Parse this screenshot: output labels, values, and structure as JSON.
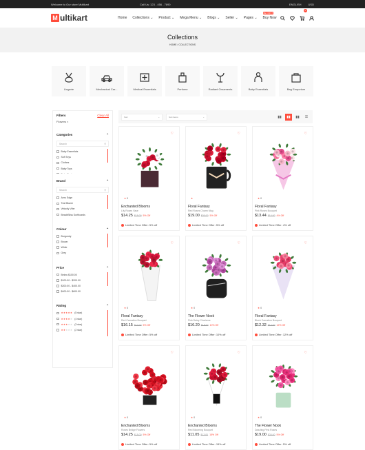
{
  "topbar": {
    "welcome": "Welcome to Our store Multikart",
    "phone": "Call Us: 123 - 456 - 7890",
    "language": "ENGLISH",
    "currency": "USD"
  },
  "header": {
    "logo_mark": "M",
    "logo_text": "ultikart",
    "nav": [
      {
        "label": "Home"
      },
      {
        "label": "Collections"
      },
      {
        "label": "Product"
      },
      {
        "label": "Mega Menu"
      },
      {
        "label": "Blogs"
      },
      {
        "label": "Seller"
      },
      {
        "label": "Pages"
      },
      {
        "label": "Buy Now",
        "badge": "BE FIRST"
      }
    ],
    "cart_count": "0"
  },
  "banner": {
    "title": "Collections",
    "breadcrumb": "HOME / COLLECTIONS"
  },
  "categories": [
    {
      "label": "Lingerie",
      "icon": "lingerie-icon"
    },
    {
      "label": "Mechanical Car...",
      "icon": "car-icon"
    },
    {
      "label": "Medical Essentials",
      "icon": "medical-icon"
    },
    {
      "label": "Perfume",
      "icon": "perfume-icon"
    },
    {
      "label": "Radiant Ornaments",
      "icon": "ornament-icon"
    },
    {
      "label": "Baby Essentials",
      "icon": "baby-icon"
    },
    {
      "label": "Bag Emporium",
      "icon": "bag-icon"
    }
  ],
  "filters": {
    "title": "Filters",
    "clear": "Clear All",
    "selected": "Flowers",
    "categories": {
      "title": "Categories",
      "placeholder": "Search",
      "items": [
        "Baby Essentials",
        "Soft Toys",
        "Clothes",
        "Baby Toys",
        "Baby Footware"
      ]
    },
    "brand": {
      "title": "Brand",
      "placeholder": "Search",
      "items": [
        "Aero Edge",
        "Trail Blazer",
        "Velocity Vibe",
        "BeachBliss Surfboards"
      ]
    },
    "colour": {
      "title": "Colour",
      "items": [
        "Burgundy",
        "Brown",
        "White",
        "Grey"
      ]
    },
    "price": {
      "title": "Price",
      "items": [
        "Below $100.00",
        "$100.00 - $200.00",
        "$200.00 - $400.00",
        "$400.00 - $600.00"
      ]
    },
    "rating": {
      "title": "Rating",
      "items": [
        {
          "stars": 5,
          "label": "(5 star)"
        },
        {
          "stars": 4,
          "label": "(4 star)"
        },
        {
          "stars": 3,
          "label": "(3 star)"
        },
        {
          "stars": 2,
          "label": "(2 star)"
        }
      ]
    }
  },
  "toolbar": {
    "sort": "Sort",
    "sort_items": "Sort Items"
  },
  "products": [
    {
      "rating": "0",
      "name": "Enchanted Blooms",
      "desc": "Lily Roses Vase",
      "price": "$14.25",
      "old": "$15.00",
      "off": "5% Off",
      "offer": "Limited Time Offer: 5% off",
      "img": "mix"
    },
    {
      "rating": "",
      "name": "Floral Fantasy",
      "desc": "Red Roses Charm Mug",
      "price": "$19.00",
      "old": "$20.00",
      "off": "5% Off",
      "offer": "Limited Time Offer: 5% off",
      "img": "red-mug"
    },
    {
      "rating": "0",
      "name": "Floral Fantasy",
      "desc": "Pink Roses Bouquet",
      "price": "$13.44",
      "old": "$14.00",
      "off": "4% Off",
      "offer": "Limited Time Offer: 4% off",
      "img": "pink-bouquet"
    },
    {
      "rating": "0",
      "name": "Floral Fantasy",
      "desc": "Red Carnation Bouquet",
      "price": "$16.15",
      "old": "$17.00",
      "off": "5% Off",
      "offer": "Limited Time Offer: 5% off",
      "img": "red-cone"
    },
    {
      "rating": "0",
      "name": "The Flower Nook",
      "desc": "Pink Daisy Charisma",
      "price": "$16.20",
      "old": "$18.00",
      "off": "10% Off",
      "offer": "Limited Time Offer: 10% off",
      "img": "purple-box"
    },
    {
      "rating": "0",
      "name": "Floral Fantasy",
      "desc": "Blush Carnation Bouquet",
      "price": "$12.32",
      "old": "$14.00",
      "off": "12% Off",
      "offer": "Limited Time Offer: 12% off",
      "img": "pink-wrap"
    },
    {
      "rating": "0",
      "name": "Enchanted Blooms",
      "desc": "Roses Bridge Flowers",
      "price": "$14.25",
      "old": "$15.00",
      "off": "5% Off",
      "offer": "Limited Time Offer: 5% off",
      "img": "red-dome"
    },
    {
      "rating": "0",
      "name": "Enchanted Blooms",
      "desc": "Red Blooming Bouquet",
      "price": "$11.05",
      "old": "$13.00",
      "off": "15% Off",
      "offer": "Limited Time Offer: 15% off",
      "img": "red-white"
    },
    {
      "rating": "0",
      "name": "The Flower Nook",
      "desc": "Dazzling Pink Roses",
      "price": "$19.00",
      "old": "$20.00",
      "off": "5% Off",
      "offer": "Limited Time Offer: 5% off",
      "img": "pink-vase"
    }
  ],
  "colors": {
    "accent": "#ff4c3b"
  }
}
